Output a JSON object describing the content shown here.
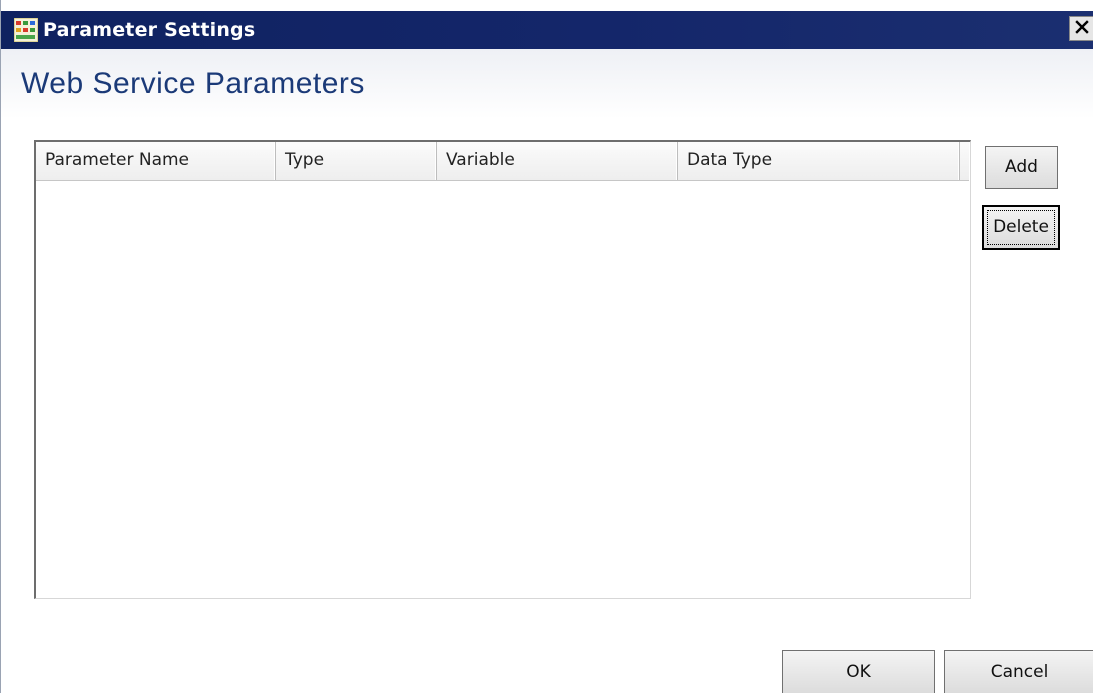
{
  "window": {
    "title": "Parameter Settings",
    "icon": "app-icon",
    "close_icon": "close-icon",
    "accent_color": "#14266a"
  },
  "heading": "Web Service Parameters",
  "parameters_table": {
    "columns": [
      "Parameter Name",
      "Type",
      "Variable",
      "Data Type"
    ],
    "rows": []
  },
  "buttons": {
    "add": "Add",
    "delete": "Delete",
    "ok": "OK",
    "cancel": "Cancel"
  }
}
